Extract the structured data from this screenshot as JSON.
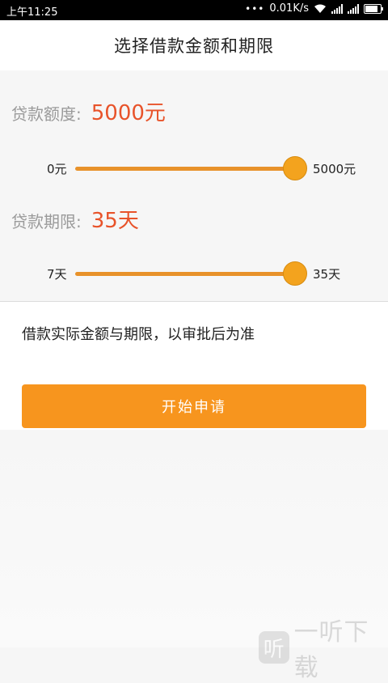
{
  "status_bar": {
    "time": "上午11:25",
    "network_speed": "0.01K/s",
    "icons": [
      "more-dots-icon",
      "wifi-icon",
      "signal-icon",
      "signal-icon",
      "battery-icon"
    ]
  },
  "header": {
    "title": "选择借款金额和期限"
  },
  "amount": {
    "label": "贷款额度:",
    "value": "5000元",
    "slider_min": "0元",
    "slider_max": "5000元",
    "level": 1.0
  },
  "term": {
    "label": "贷款期限:",
    "value": "35天",
    "slider_min": "7天",
    "slider_max": "35天",
    "level": 1.0
  },
  "notice": "借款实际金额与期限，以审批后为准",
  "apply_button": {
    "label": "开始申请"
  },
  "watermark": {
    "logo": "听",
    "text": "一听下载"
  },
  "colors": {
    "accent": "#f7951e",
    "value_red": "#e8532a",
    "track": "#e8922a"
  }
}
